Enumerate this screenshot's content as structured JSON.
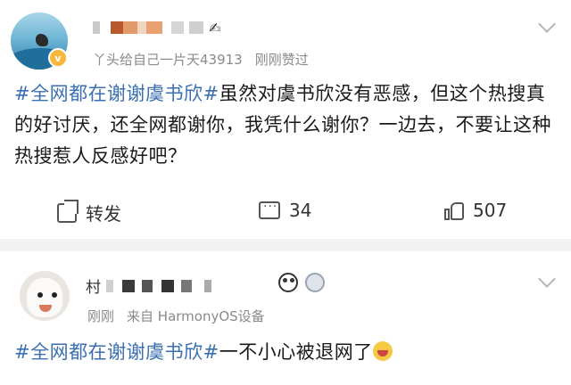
{
  "post1": {
    "meta_text": "丫头给自己一片天43913",
    "time": "刚刚赞过",
    "vip_badge": "v",
    "hashtag": "#全网都在谢谢虞书欣#",
    "content": "虽然对虞书欣没有恶感，但这个热搜真的好讨厌，还全网都谢你，我凭什么谢你？一边去，不要让这种热搜惹人反感好吧？",
    "actions": {
      "share_label": "转发",
      "comment_count": "34",
      "like_count": "507"
    }
  },
  "post2": {
    "username_first_char": "村",
    "time": "刚刚",
    "source": "来自 HarmonyOS设备",
    "hashtag": "#全网都在谢谢虞书欣#",
    "content": "一不小心被退网了"
  },
  "colors": {
    "hashtag": "#3a6fb3",
    "meta": "#8a8a8a",
    "divider": "#f2f2f2"
  },
  "icons": [
    "share-icon",
    "comment-icon",
    "like-icon",
    "chevron-down-icon",
    "laugh-emoji-icon",
    "panda-badge-icon",
    "medal-badge-icon"
  ]
}
